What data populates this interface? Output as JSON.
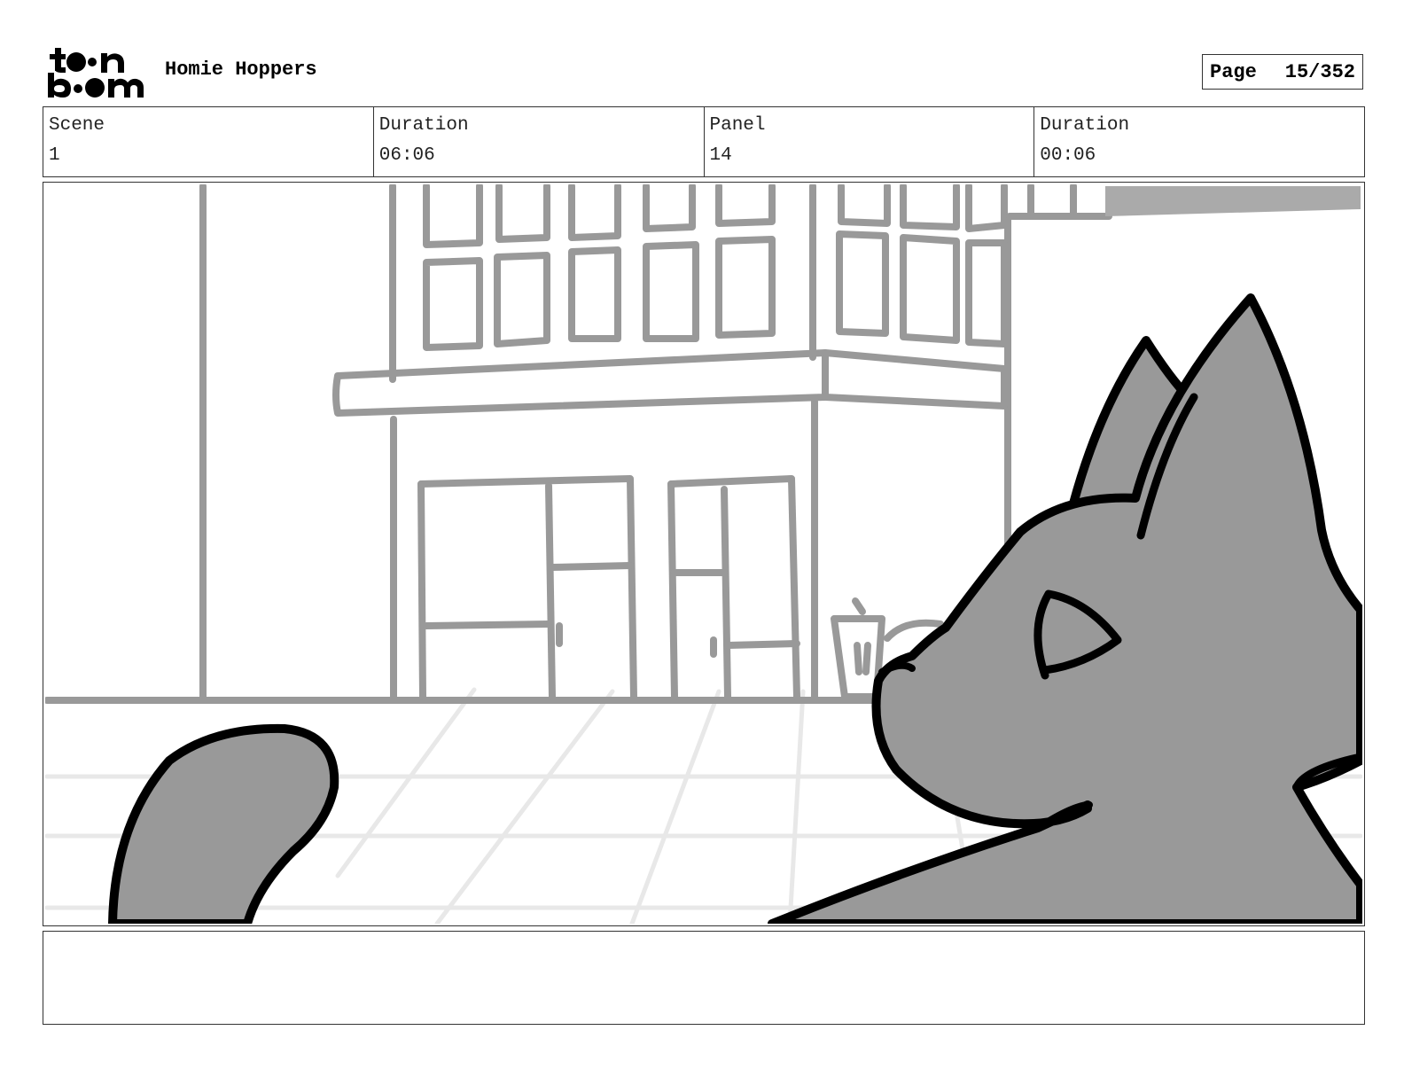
{
  "header": {
    "logo_alt": "toon boom",
    "project_title": "Homie Hoppers",
    "page_label": "Page",
    "page_value": "15/352"
  },
  "info": {
    "scene_label": "Scene",
    "scene_value": "1",
    "scene_duration_label": "Duration",
    "scene_duration_value": "06:06",
    "panel_label": "Panel",
    "panel_value": "14",
    "panel_duration_label": "Duration",
    "panel_duration_value": "00:06"
  },
  "panel_drawing": {
    "subject": "cat-with-eyes-closed-in-front-of-building",
    "colors": {
      "building_line": "#999999",
      "sidewalk_line": "#e6e6e6",
      "cat_fill": "#999999",
      "outline": "#000000",
      "awning": "#aaaaaa"
    }
  },
  "notes": {
    "text": ""
  }
}
